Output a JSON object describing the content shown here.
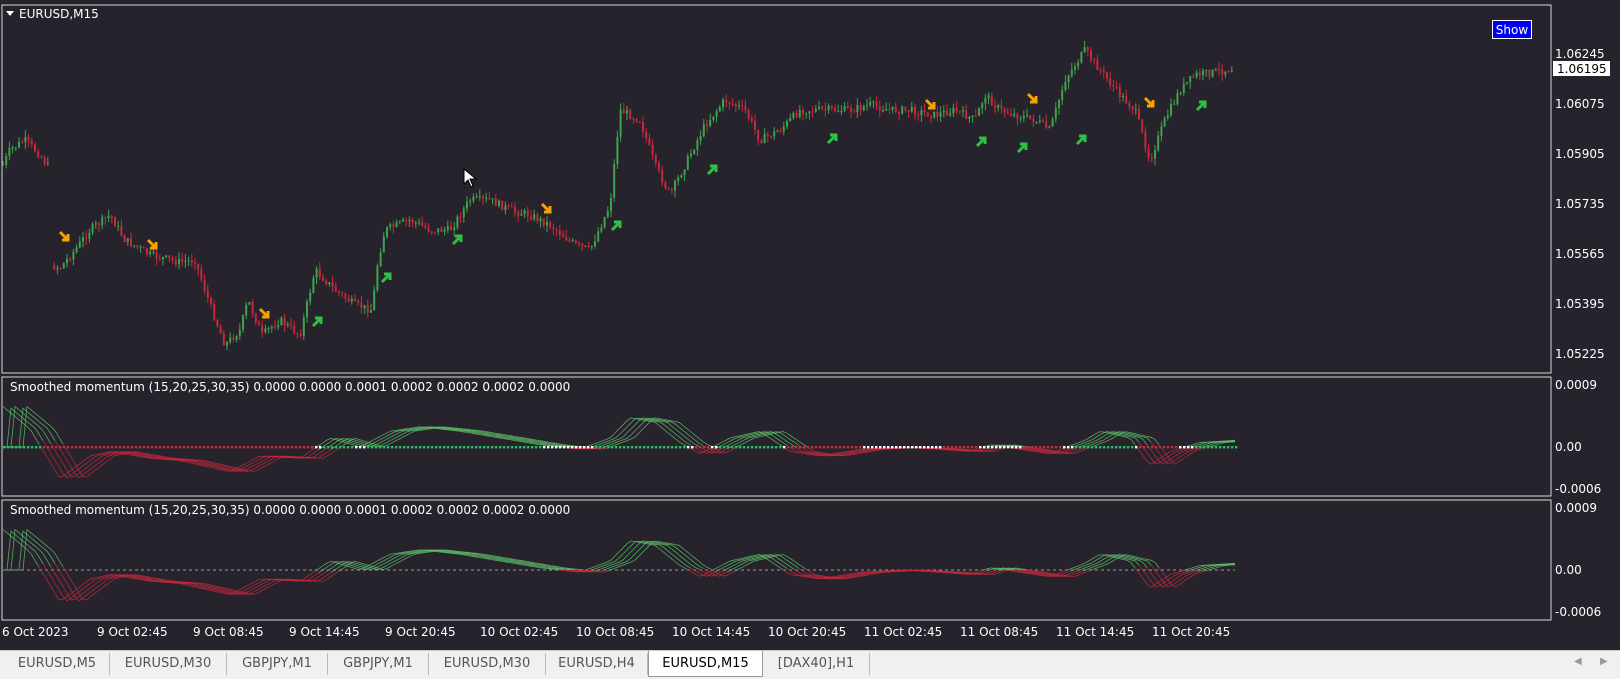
{
  "main_chart": {
    "title": "EURUSD,M15",
    "show_button_label": "Show",
    "price_levels": [
      "1.06245",
      "1.06075",
      "1.05905",
      "1.05735",
      "1.05565",
      "1.05395",
      "1.05225"
    ],
    "current_price": "1.06195"
  },
  "indicator_panel_1": {
    "label": "Smoothed momentum (15,20,25,30,35) 0.0000 0.0000 0.0001 0.0002 0.0002 0.0002 0.0000",
    "levels": [
      "0.0009",
      "0.00",
      "-0.0006"
    ]
  },
  "indicator_panel_2": {
    "label": "Smoothed momentum (15,20,25,30,35) 0.0000 0.0000 0.0001 0.0002 0.0002 0.0002 0.0000",
    "levels": [
      "0.0009",
      "0.00",
      "-0.0006"
    ]
  },
  "time_axis": [
    "6 Oct 2023",
    "9 Oct 02:45",
    "9 Oct 08:45",
    "9 Oct 14:45",
    "9 Oct 20:45",
    "10 Oct 02:45",
    "10 Oct 08:45",
    "10 Oct 14:45",
    "10 Oct 20:45",
    "11 Oct 02:45",
    "11 Oct 08:45",
    "11 Oct 14:45",
    "11 Oct 20:45"
  ],
  "tabs": [
    {
      "label": "EURUSD,M5"
    },
    {
      "label": "EURUSD,M30"
    },
    {
      "label": "GBPJPY,M1"
    },
    {
      "label": "GBPJPY,M1"
    },
    {
      "label": "EURUSD,M30"
    },
    {
      "label": "EURUSD,H4"
    },
    {
      "label": "EURUSD,M15",
      "active": true
    },
    {
      "label": "[DAX40],H1"
    }
  ],
  "colors": {
    "background": "#26232c",
    "bull": "#3fa34d",
    "bear": "#c8283c",
    "buy_arrow": "#2fc142",
    "sell_arrow": "#f5a300",
    "show_button": "#0000f0"
  },
  "icons": [
    "triangle-down-icon",
    "buy-arrow-icon",
    "sell-arrow-icon",
    "scroll-left-icon",
    "scroll-right-icon"
  ]
}
